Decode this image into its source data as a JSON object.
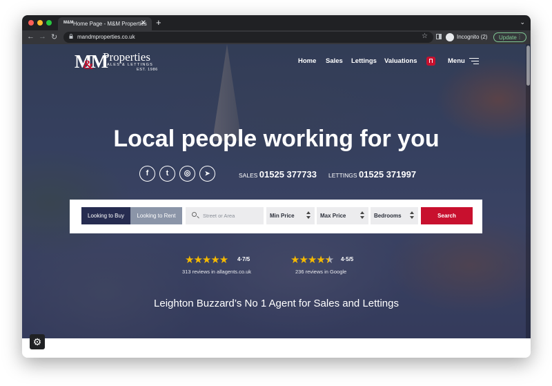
{
  "browser": {
    "tab_title": "Home Page - M&M Properties",
    "tab_favicon": "M&M",
    "url": "mandmproperties.co.uk",
    "profile_label": "Incognito (2)",
    "update_label": "Update",
    "new_tab_glyph": "+",
    "close_glyph": "✕",
    "chevron_glyph": "⌄",
    "back_glyph": "←",
    "forward_glyph": "→",
    "reload_glyph": "↻",
    "star_glyph": "☆",
    "more_glyph": "⋮"
  },
  "logo": {
    "mm": "MM",
    "amp": "&",
    "properties": "Properties",
    "subtitle": "SALES & LETTINGS",
    "est": "EST. 1986"
  },
  "nav": {
    "items": [
      "Home",
      "Sales",
      "Lettings",
      "Valuations"
    ],
    "menu_label": "Menu"
  },
  "hero": {
    "headline": "Local people working for you",
    "social": {
      "facebook": "f",
      "twitter": "t",
      "instagram": "◎",
      "telegram": "➤"
    },
    "sales_label": "SALES",
    "sales_number": "01525 377733",
    "lettings_label": "LETTINGS",
    "lettings_number": "01525 371997",
    "tagline": "Leighton Buzzard’s No 1 Agent for Sales and Lettings"
  },
  "search": {
    "tab_buy": "Looking to Buy",
    "tab_rent": "Looking to Rent",
    "location_placeholder": "Street or Area",
    "min_price": "Min Price",
    "max_price": "Max Price",
    "bedrooms": "Bedrooms",
    "button": "Search"
  },
  "ratings": [
    {
      "score": "4·7/5",
      "reviews": "313 reviews in allagents.co.uk",
      "stars_full": 5,
      "stars_text": "★★★★★"
    },
    {
      "score": "4·5/5",
      "reviews": "236 reviews in Google",
      "stars_full": 4.5,
      "stars_text": "★★★★"
    }
  ],
  "settings_glyph": "⚙",
  "colors": {
    "brand_navy": "#262c50",
    "brand_red": "#c8102e",
    "star_gold": "#f5b900"
  }
}
